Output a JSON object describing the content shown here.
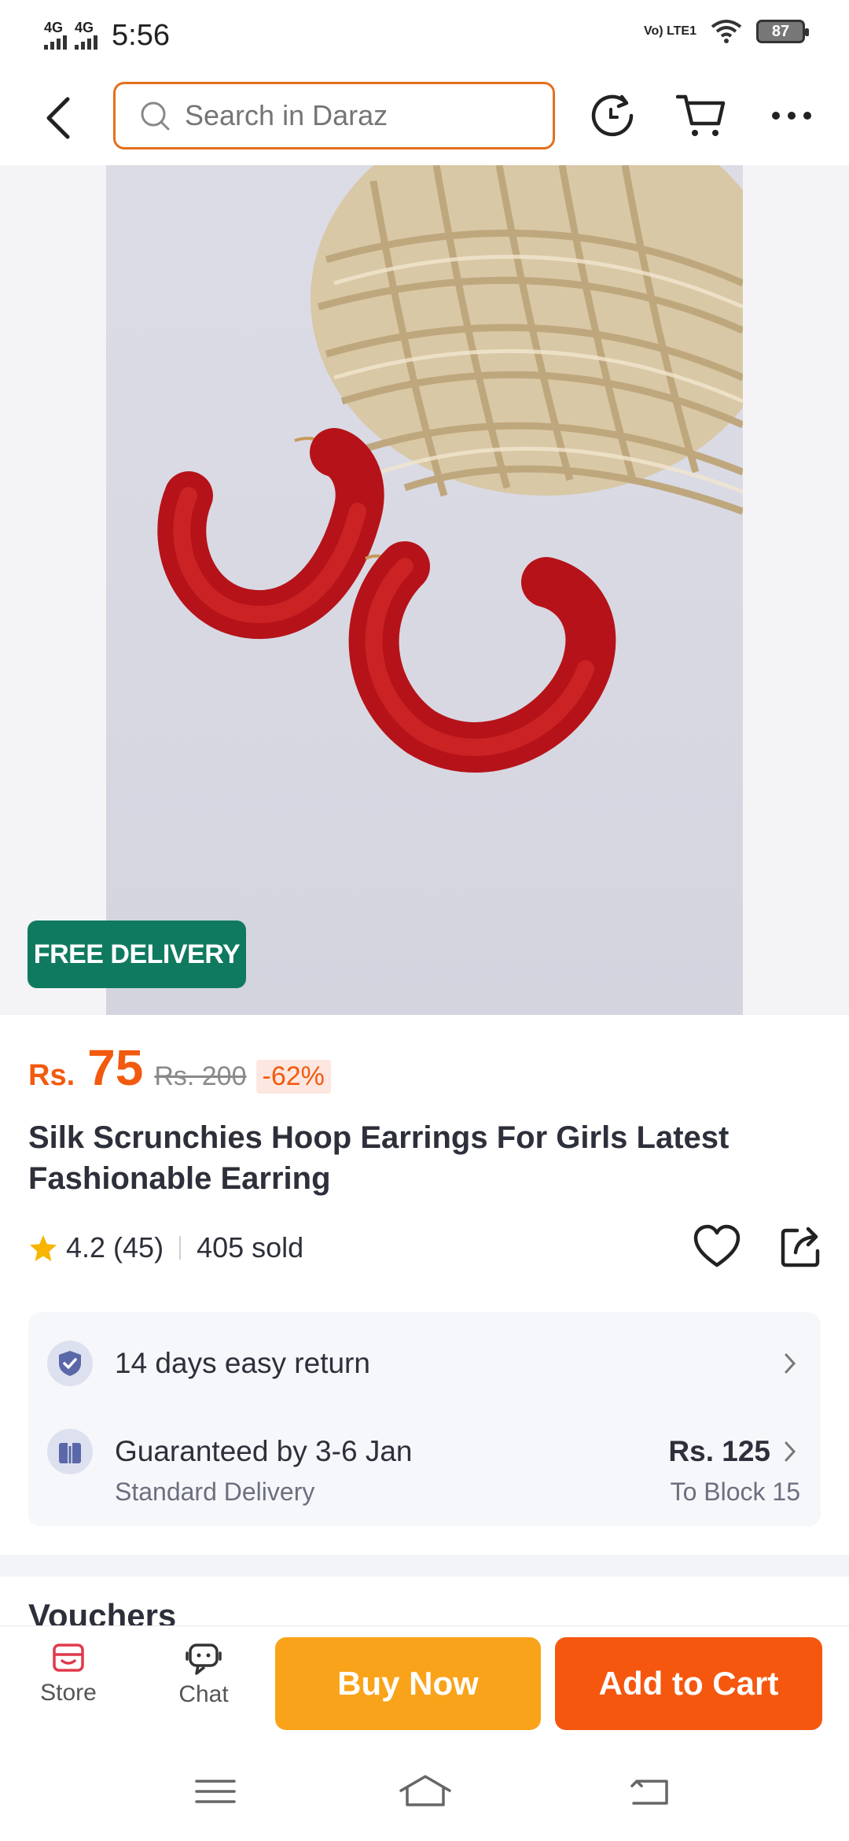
{
  "status_bar": {
    "signal1": "4G",
    "signal2": "4G",
    "time": "5:56",
    "volte": "Vo) LTE1",
    "battery": "87"
  },
  "top_bar": {
    "search_placeholder": "Search in Daraz",
    "icons": [
      "back-icon",
      "search-icon",
      "history-refresh-icon",
      "cart-icon",
      "more-icon"
    ]
  },
  "gallery": {
    "badge": "FREE DELIVERY"
  },
  "price": {
    "currency": "Rs.",
    "current": "75",
    "original": "Rs. 200",
    "discount": "-62%"
  },
  "product": {
    "title": "Silk Scrunchies Hoop Earrings For Girls Latest Fashionable Earring",
    "rating": "4.2",
    "reviews": "(45)",
    "sold": "405 sold"
  },
  "info": {
    "returns": "14 days easy return",
    "delivery": "Guaranteed by 3-6 Jan",
    "delivery_type": "Standard Delivery",
    "delivery_fee": "Rs. 125",
    "delivery_location": "To Block 15"
  },
  "vouchers_label": "Vouchers",
  "action_bar": {
    "store": "Store",
    "chat": "Chat",
    "buy_now": "Buy Now",
    "add_to_cart": "Add to Cart"
  },
  "colors": {
    "accent": "#f25a0f",
    "buy_now": "#f9a31a",
    "add_to_cart": "#f5570f",
    "badge": "#0f7a5f",
    "search_border": "#e4701e"
  }
}
